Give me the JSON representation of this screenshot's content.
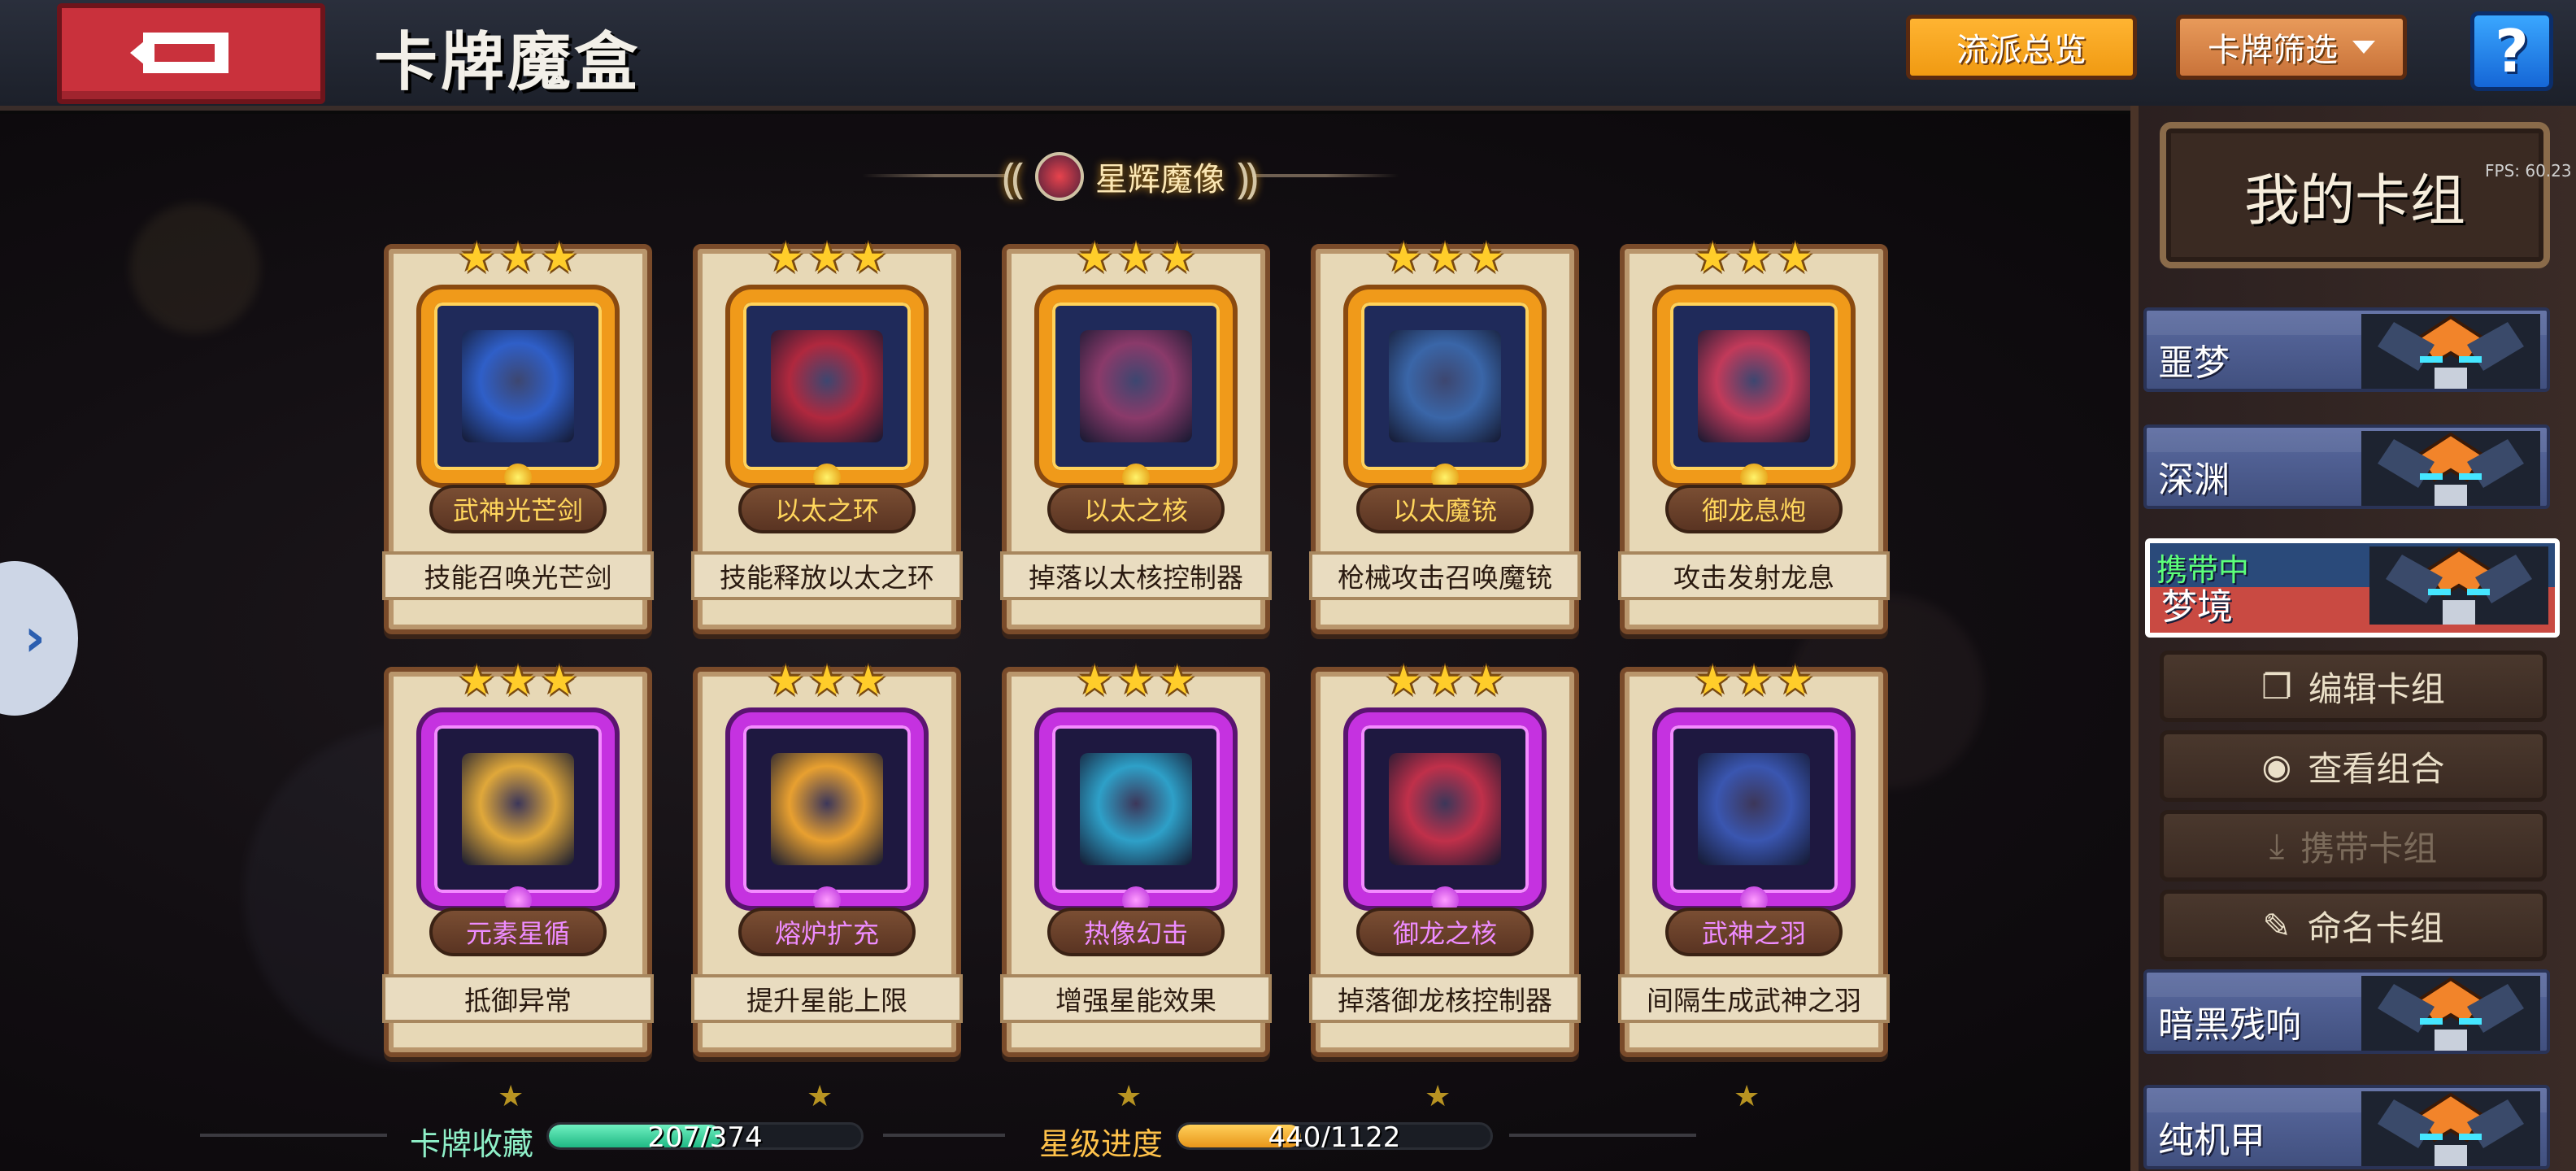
{
  "header": {
    "title": "卡牌魔盒",
    "overview_button": "流派总览",
    "filter_button": "卡牌筛选",
    "help_button": "?"
  },
  "section": {
    "title": "星辉魔像"
  },
  "cards": [
    {
      "name": "武神光芒剑",
      "desc": "技能召唤光芒剑",
      "stars": 3,
      "rarity": "gold",
      "art_color": "#2f5fc8"
    },
    {
      "name": "以太之环",
      "desc": "技能释放以太之环",
      "stars": 3,
      "rarity": "gold",
      "art_color": "#b0283e"
    },
    {
      "name": "以太之核",
      "desc": "掉落以太核控制器",
      "stars": 3,
      "rarity": "gold",
      "art_color": "#8a3a6a"
    },
    {
      "name": "以太魔铳",
      "desc": "枪械攻击召唤魔铳",
      "stars": 3,
      "rarity": "gold",
      "art_color": "#3a66a8"
    },
    {
      "name": "御龙息炮",
      "desc": "攻击发射龙息",
      "stars": 3,
      "rarity": "gold",
      "art_color": "#c23a5a"
    },
    {
      "name": "元素星循",
      "desc": "抵御异常",
      "stars": 3,
      "rarity": "purple",
      "art_color": "#e0a83a"
    },
    {
      "name": "熔炉扩充",
      "desc": "提升星能上限",
      "stars": 3,
      "rarity": "purple",
      "art_color": "#e8a030"
    },
    {
      "name": "热像幻击",
      "desc": "增强星能效果",
      "stars": 3,
      "rarity": "purple",
      "art_color": "#2ea0c8"
    },
    {
      "name": "御龙之核",
      "desc": "掉落御龙核控制器",
      "stars": 3,
      "rarity": "purple",
      "art_color": "#c0304a"
    },
    {
      "name": "武神之羽",
      "desc": "间隔生成武神之羽",
      "stars": 3,
      "rarity": "purple",
      "art_color": "#3a56b0"
    }
  ],
  "stats": {
    "collection_label": "卡牌收藏",
    "collection_value": "207/374",
    "collection_fraction": 0.553,
    "star_label": "星级进度",
    "star_value": "440/1122",
    "star_fraction": 0.392
  },
  "panel": {
    "title": "我的卡组",
    "decks": [
      {
        "name": "噩梦",
        "active": false,
        "status": ""
      },
      {
        "name": "深渊",
        "active": false,
        "status": ""
      },
      {
        "name": "梦境",
        "active": true,
        "status": "携带中"
      },
      {
        "name": "暗黑残响",
        "active": false,
        "status": ""
      },
      {
        "name": "纯机甲",
        "active": false,
        "status": ""
      }
    ],
    "buttons": {
      "edit": "编辑卡组",
      "view": "查看组合",
      "carry": "携带卡组",
      "rename": "命名卡组"
    }
  },
  "fps": "FPS: 60.23",
  "colors": {
    "gold_accent": "#f09a1a",
    "purple_accent": "#c532e0",
    "collection_bar": "#3ad6a0",
    "star_bar": "#f0a828",
    "active_deck": "#c94a42"
  }
}
